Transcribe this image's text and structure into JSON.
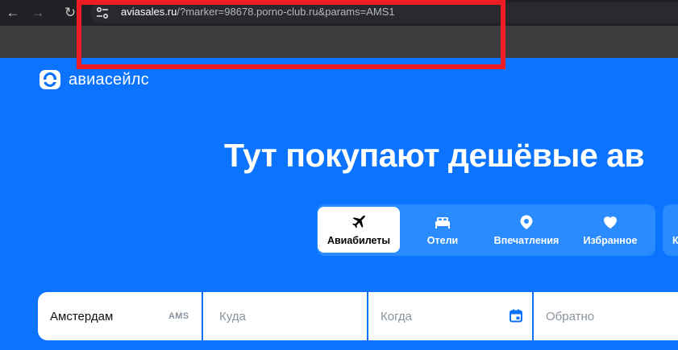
{
  "browser": {
    "url_host": "aviasales.ru",
    "url_rest": "/?marker=98678.porno-club.ru&params=AMS1",
    "back": "←",
    "forward": "→",
    "reload": "↻"
  },
  "brand": {
    "name": "авиасейлс"
  },
  "hero": {
    "title": "Тут покупают дешёвые ав"
  },
  "tabs": [
    {
      "label": "Авиабилеты",
      "icon": "plane-icon",
      "active": true
    },
    {
      "label": "Отели",
      "icon": "bed-icon",
      "active": false
    },
    {
      "label": "Впечатления",
      "icon": "location-pin-icon",
      "active": false
    },
    {
      "label": "Избранное",
      "icon": "heart-icon",
      "active": false
    }
  ],
  "tab_more": {
    "label": "К"
  },
  "search": {
    "origin": {
      "value": "Амстердам",
      "code": "AMS"
    },
    "destination": {
      "placeholder": "Куда"
    },
    "depart": {
      "placeholder": "Когда",
      "icon": "calendar-icon"
    },
    "return": {
      "placeholder": "Обратно"
    }
  },
  "colors": {
    "brand_blue": "#0c73fe",
    "highlight": "#ee1c25"
  }
}
